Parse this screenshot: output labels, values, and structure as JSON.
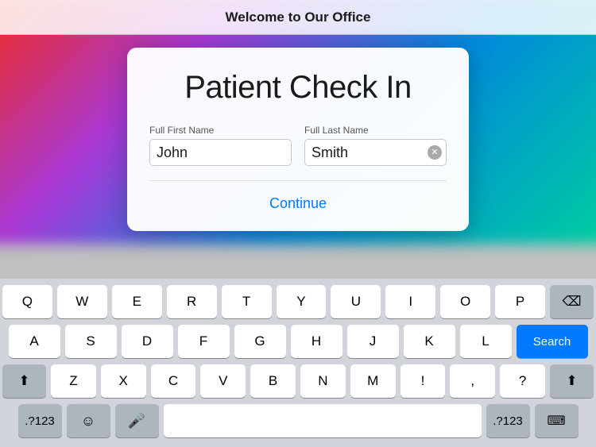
{
  "topBar": {
    "title": "Welcome to Our Office"
  },
  "card": {
    "title": "Patient Check In",
    "firstNameLabel": "Full First Name",
    "firstNameValue": "John",
    "lastNameLabel": "Full Last Name",
    "lastNameValue": "Smith",
    "continueLabel": "Continue"
  },
  "keyboard": {
    "rows": [
      [
        "Q",
        "W",
        "E",
        "R",
        "T",
        "Y",
        "U",
        "I",
        "O",
        "P"
      ],
      [
        "A",
        "S",
        "D",
        "F",
        "G",
        "H",
        "J",
        "K",
        "L"
      ],
      [
        "Z",
        "X",
        "C",
        "V",
        "B",
        "N",
        "M",
        "!",
        ",",
        "?"
      ]
    ],
    "searchLabel": "Search",
    "numberLabel": ".?123",
    "spacebarLabel": ""
  }
}
